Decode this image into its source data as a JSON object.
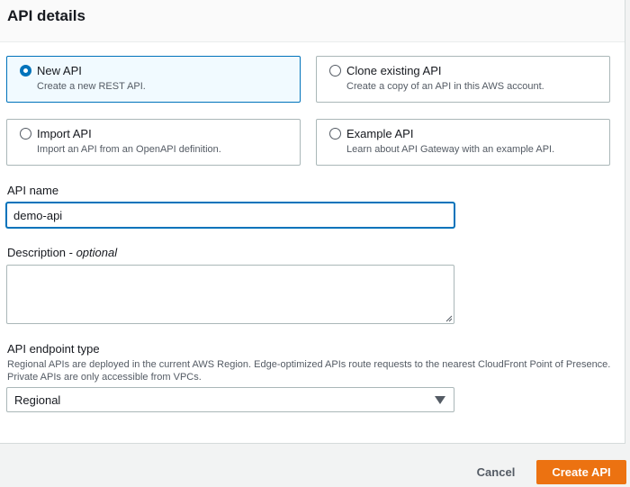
{
  "panel": {
    "title": "API details"
  },
  "options": [
    {
      "label": "New API",
      "description": "Create a new REST API.",
      "selected": true
    },
    {
      "label": "Clone existing API",
      "description": "Create a copy of an API in this AWS account.",
      "selected": false
    },
    {
      "label": "Import API",
      "description": "Import an API from an OpenAPI definition.",
      "selected": false
    },
    {
      "label": "Example API",
      "description": "Learn about API Gateway with an example API.",
      "selected": false
    }
  ],
  "api_name": {
    "label": "API name",
    "value": "demo-api"
  },
  "description": {
    "label": "Description - ",
    "optional": "optional",
    "value": ""
  },
  "endpoint": {
    "label": "API endpoint type",
    "help": "Regional APIs are deployed in the current AWS Region. Edge-optimized APIs route requests to the nearest CloudFront Point of Presence. Private APIs are only accessible from VPCs.",
    "selected": "Regional"
  },
  "footer": {
    "cancel_label": "Cancel",
    "create_label": "Create API"
  },
  "colors": {
    "accent": "#0073bb",
    "primary_button": "#ec7211"
  }
}
